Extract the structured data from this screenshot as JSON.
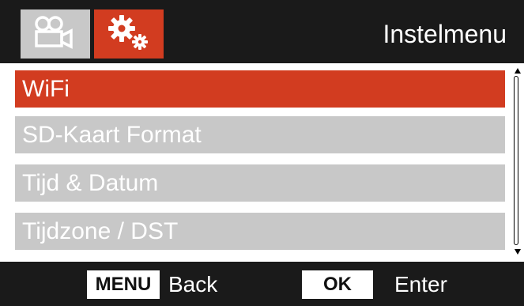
{
  "header": {
    "tabs": [
      {
        "icon": "video-camera-icon",
        "active": false
      },
      {
        "icon": "settings-gears-icon",
        "active": true
      }
    ],
    "title": "Instelmenu"
  },
  "menu": {
    "items": [
      {
        "label": "WiFi",
        "selected": true
      },
      {
        "label": "SD-Kaart Format",
        "selected": false
      },
      {
        "label": "Tijd & Datum",
        "selected": false
      },
      {
        "label": "Tijdzone / DST",
        "selected": false
      }
    ]
  },
  "footer": {
    "menu_key": "MENU",
    "menu_action": "Back",
    "ok_key": "OK",
    "ok_action": "Enter"
  },
  "colors": {
    "accent": "#d23c20",
    "inactive": "#c8c8c8",
    "bar": "#1a1a1a"
  }
}
